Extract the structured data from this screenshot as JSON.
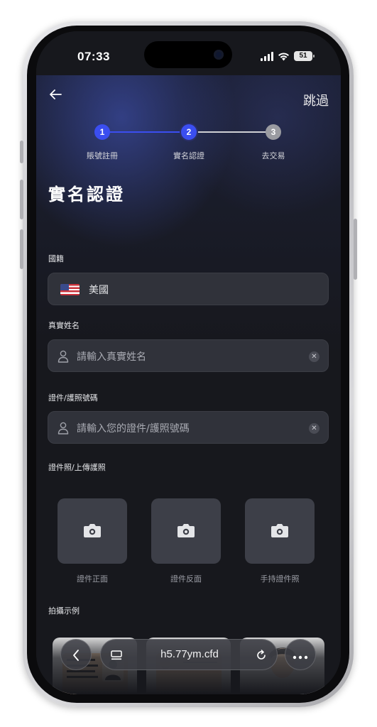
{
  "status_bar": {
    "time": "07:33",
    "battery": "51"
  },
  "header": {
    "back_icon": "arrow-left-icon",
    "skip_label": "跳過"
  },
  "steps": [
    {
      "number": "1",
      "label": "賬號註冊",
      "state": "done"
    },
    {
      "number": "2",
      "label": "實名認證",
      "state": "active"
    },
    {
      "number": "3",
      "label": "去交易",
      "state": "pending"
    }
  ],
  "colors": {
    "accent": "#3b4ef0",
    "pending": "#9a9ba1",
    "background": "#17181d"
  },
  "page_title": "實名認證",
  "nationality": {
    "label": "國籍",
    "value": "美國",
    "flag_icon": "us-flag-icon"
  },
  "real_name": {
    "label": "真實姓名",
    "placeholder": "請輸入真實姓名",
    "value": ""
  },
  "id_number": {
    "label": "證件/護照號碼",
    "placeholder": "請輸入您的證件/護照號碼",
    "value": ""
  },
  "id_photo": {
    "label": "證件照/上傳護照",
    "slots": [
      {
        "label": "證件正面",
        "icon": "camera-icon"
      },
      {
        "label": "證件反面",
        "icon": "camera-icon"
      },
      {
        "label": "手持證件照",
        "icon": "camera-icon"
      }
    ]
  },
  "examples": {
    "label": "拍攝示例"
  },
  "browser": {
    "url": "h5.77ym.cfd"
  }
}
